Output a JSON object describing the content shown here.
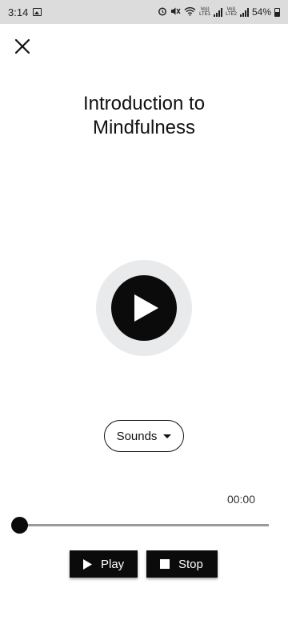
{
  "status_bar": {
    "time": "3:14",
    "net1_top": "Vo))",
    "net1_bottom": "LTE1",
    "net2_top": "Vo))",
    "net2_bottom": "LTE2",
    "battery": "54%"
  },
  "title": "Introduction to Mindfulness",
  "sounds": {
    "label": "Sounds"
  },
  "player": {
    "time": "00:00",
    "progress": 0.0,
    "play_label": "Play",
    "stop_label": "Stop"
  },
  "colors": {
    "accent": "#0b0b0b",
    "play_ring": "#e9eaec",
    "track": "#9a9a9a"
  },
  "icons": {
    "close": "close-icon",
    "big_play": "play-icon",
    "sounds_caret": "caret-down-icon",
    "play": "play-icon",
    "stop": "stop-icon"
  }
}
